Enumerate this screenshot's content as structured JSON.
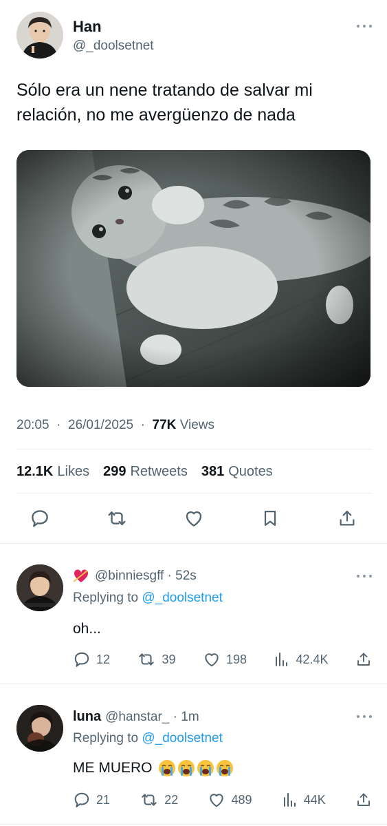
{
  "tweet": {
    "author_name": "Han",
    "author_handle": "@_doolsetnet",
    "text": "Sólo era un nene tratando de salvar mi relación, no me avergüenzo de nada",
    "time": "20:05",
    "date": "26/01/2025",
    "views_count": "77K",
    "views_label": "Views",
    "likes_count": "12.1K",
    "likes_label": "Likes",
    "retweets_count": "299",
    "retweets_label": "Retweets",
    "quotes_count": "381",
    "quotes_label": "Quotes"
  },
  "replies": [
    {
      "emoji": "heart-with-arrow-emoji",
      "handle": "@binniesgff",
      "time": "52s",
      "replying_prefix": "Replying to",
      "replying_to": "@_doolsetnet",
      "text": "oh...",
      "reply_count": "12",
      "retweet_count": "39",
      "like_count": "198",
      "view_count": "42.4K"
    },
    {
      "name": "luna",
      "handle": "@hanstar_",
      "time": "1m",
      "replying_prefix": "Replying to",
      "replying_to": "@_doolsetnet",
      "text": "ME MUERO",
      "text_emoji": "loudly-crying-face-emoji x4",
      "reply_count": "21",
      "retweet_count": "22",
      "like_count": "489",
      "view_count": "44K"
    }
  ],
  "colors": {
    "text": "#0f1419",
    "secondary": "#536471",
    "link": "#1d9bf0",
    "divider": "#e6ecf0",
    "heart_emoji": "#e0245e"
  }
}
